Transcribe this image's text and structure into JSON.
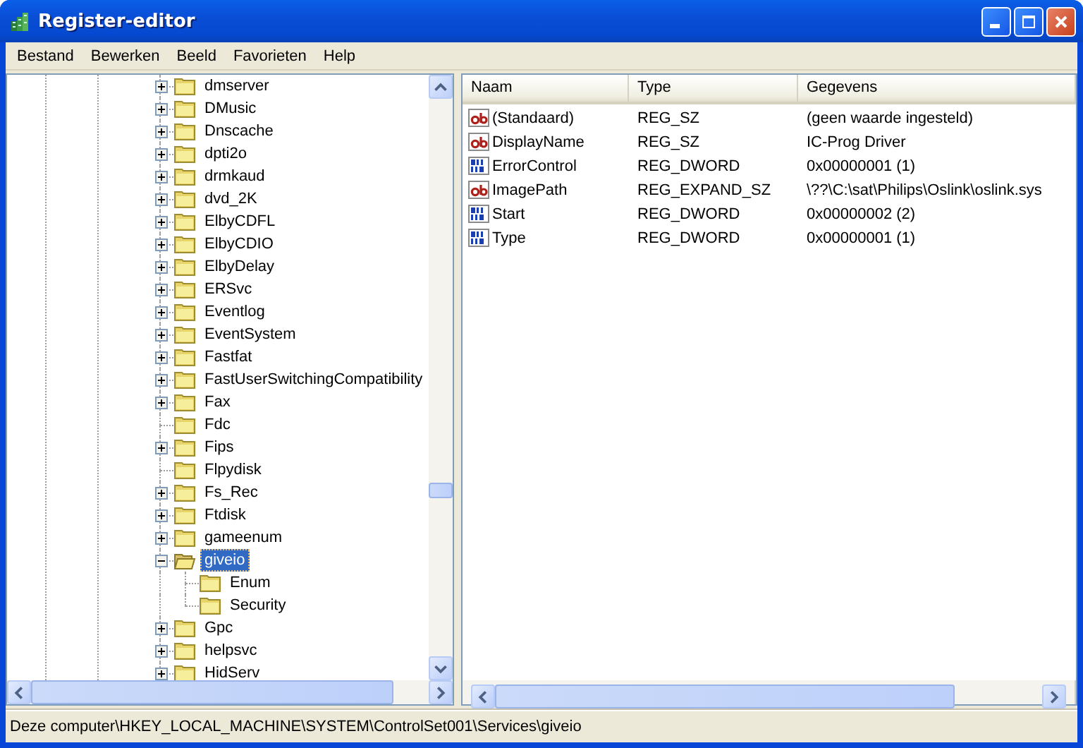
{
  "window": {
    "title": "Register-editor"
  },
  "menu": [
    {
      "label": "Bestand"
    },
    {
      "label": "Bewerken"
    },
    {
      "label": "Beeld"
    },
    {
      "label": "Favorieten"
    },
    {
      "label": "Help"
    }
  ],
  "tree": {
    "items": [
      {
        "name": "dmserver",
        "expandable": true,
        "expanded": false,
        "selected": false
      },
      {
        "name": "DMusic",
        "expandable": true,
        "expanded": false,
        "selected": false
      },
      {
        "name": "Dnscache",
        "expandable": true,
        "expanded": false,
        "selected": false
      },
      {
        "name": "dpti2o",
        "expandable": true,
        "expanded": false,
        "selected": false
      },
      {
        "name": "drmkaud",
        "expandable": true,
        "expanded": false,
        "selected": false
      },
      {
        "name": "dvd_2K",
        "expandable": true,
        "expanded": false,
        "selected": false
      },
      {
        "name": "ElbyCDFL",
        "expandable": true,
        "expanded": false,
        "selected": false
      },
      {
        "name": "ElbyCDIO",
        "expandable": true,
        "expanded": false,
        "selected": false
      },
      {
        "name": "ElbyDelay",
        "expandable": true,
        "expanded": false,
        "selected": false
      },
      {
        "name": "ERSvc",
        "expandable": true,
        "expanded": false,
        "selected": false
      },
      {
        "name": "Eventlog",
        "expandable": true,
        "expanded": false,
        "selected": false
      },
      {
        "name": "EventSystem",
        "expandable": true,
        "expanded": false,
        "selected": false
      },
      {
        "name": "Fastfat",
        "expandable": true,
        "expanded": false,
        "selected": false
      },
      {
        "name": "FastUserSwitchingCompatibility",
        "expandable": true,
        "expanded": false,
        "selected": false
      },
      {
        "name": "Fax",
        "expandable": true,
        "expanded": false,
        "selected": false
      },
      {
        "name": "Fdc",
        "expandable": false,
        "expanded": false,
        "selected": false
      },
      {
        "name": "Fips",
        "expandable": true,
        "expanded": false,
        "selected": false
      },
      {
        "name": "Flpydisk",
        "expandable": false,
        "expanded": false,
        "selected": false
      },
      {
        "name": "Fs_Rec",
        "expandable": true,
        "expanded": false,
        "selected": false
      },
      {
        "name": "Ftdisk",
        "expandable": true,
        "expanded": false,
        "selected": false
      },
      {
        "name": "gameenum",
        "expandable": true,
        "expanded": false,
        "selected": false
      },
      {
        "name": "giveio",
        "expandable": true,
        "expanded": true,
        "selected": true,
        "children": [
          {
            "name": "Enum",
            "expandable": false,
            "expanded": false,
            "selected": false
          },
          {
            "name": "Security",
            "expandable": false,
            "expanded": false,
            "selected": false
          }
        ]
      },
      {
        "name": "Gpc",
        "expandable": true,
        "expanded": false,
        "selected": false
      },
      {
        "name": "helpsvc",
        "expandable": true,
        "expanded": false,
        "selected": false
      },
      {
        "name": "HidServ",
        "expandable": true,
        "expanded": false,
        "selected": false
      }
    ]
  },
  "values": {
    "columns": [
      "Naam",
      "Type",
      "Gegevens"
    ],
    "rows": [
      {
        "kind": "string",
        "name": "(Standaard)",
        "type": "REG_SZ",
        "data": "(geen waarde ingesteld)"
      },
      {
        "kind": "string",
        "name": "DisplayName",
        "type": "REG_SZ",
        "data": "IC-Prog Driver"
      },
      {
        "kind": "binary",
        "name": "ErrorControl",
        "type": "REG_DWORD",
        "data": "0x00000001 (1)"
      },
      {
        "kind": "string",
        "name": "ImagePath",
        "type": "REG_EXPAND_SZ",
        "data": "\\??\\C:\\sat\\Philips\\Oslink\\oslink.sys"
      },
      {
        "kind": "binary",
        "name": "Start",
        "type": "REG_DWORD",
        "data": "0x00000002 (2)"
      },
      {
        "kind": "binary",
        "name": "Type",
        "type": "REG_DWORD",
        "data": "0x00000001 (1)"
      }
    ]
  },
  "status_bar": "Deze computer\\HKEY_LOCAL_MACHINE\\SYSTEM\\ControlSet001\\Services\\giveio"
}
